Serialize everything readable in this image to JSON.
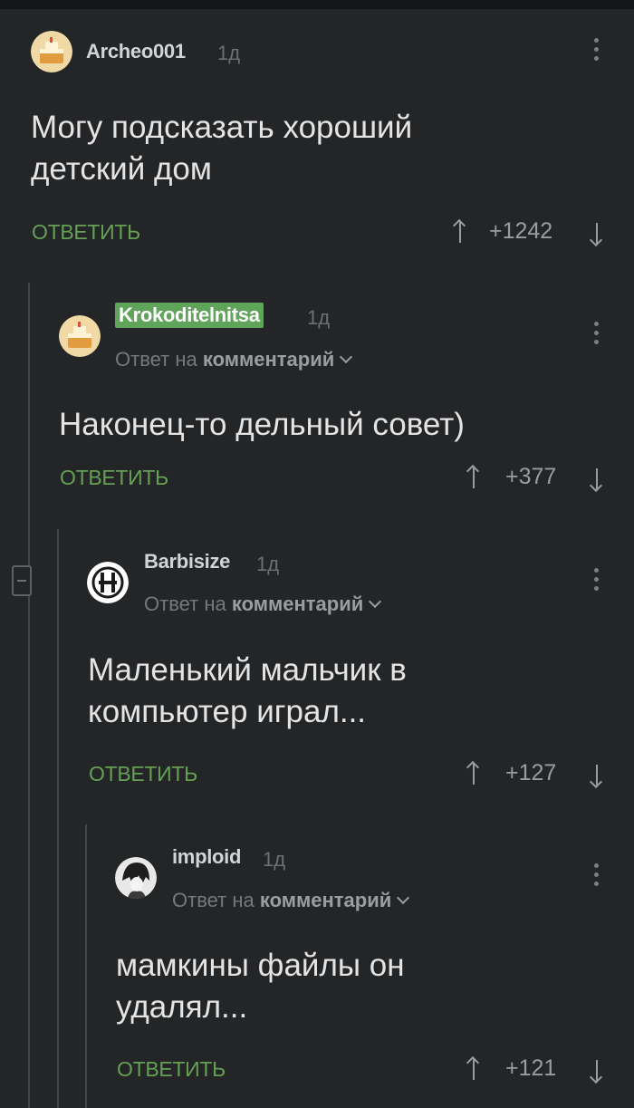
{
  "colors": {
    "background": "#232527",
    "accent_green": "#65a155",
    "badge_green": "#60a35a"
  },
  "comments": [
    {
      "username": "Archeo001",
      "time": "1д",
      "text_lines": [
        "Могу подсказать хороший",
        "детский дом"
      ],
      "reply_label": "ОТВЕТИТЬ",
      "rating": "+1242",
      "avatar_icon": "cake-avatar-icon"
    },
    {
      "username": "Krokoditelnitsa",
      "time": "1д",
      "reply_to_prefix": "Ответ на",
      "reply_to_target": "комментарий",
      "text_lines": [
        "Наконец-то дельный совет)"
      ],
      "reply_label": "ОТВЕТИТЬ",
      "rating": "+377",
      "avatar_icon": "cake-avatar-icon"
    },
    {
      "username": "Barbisize",
      "time": "1д",
      "reply_to_prefix": "Ответ на",
      "reply_to_target": "комментарий",
      "text_lines": [
        "Маленький мальчик в",
        "компьютер играл..."
      ],
      "reply_label": "ОТВЕТИТЬ",
      "rating": "+127",
      "avatar_icon": "rammstein-logo-avatar-icon"
    },
    {
      "username": "imploid",
      "time": "1д",
      "reply_to_prefix": "Ответ на",
      "reply_to_target": "комментарий",
      "text_lines": [
        "мамкины файлы он",
        "удалял..."
      ],
      "reply_label": "ОТВЕТИТЬ",
      "rating": "+121",
      "avatar_icon": "anime-character-avatar-icon"
    }
  ]
}
